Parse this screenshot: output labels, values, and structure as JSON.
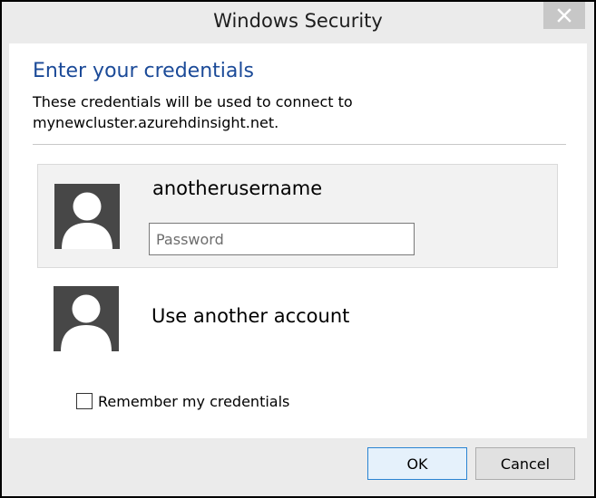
{
  "window": {
    "title": "Windows Security",
    "close_icon": "close-icon"
  },
  "dialog": {
    "heading": "Enter your credentials",
    "description": "These credentials will be used to connect to mynewcluster.azurehdinsight.net."
  },
  "accounts": [
    {
      "username": "anotherusername",
      "avatar_icon": "user-silhouette-icon",
      "password": {
        "value": "",
        "placeholder": "Password"
      }
    },
    {
      "label": "Use another account",
      "avatar_icon": "user-silhouette-icon"
    }
  ],
  "remember": {
    "label": "Remember my credentials",
    "checked": false
  },
  "buttons": {
    "ok": "OK",
    "cancel": "Cancel"
  },
  "colors": {
    "heading": "#1b4a98",
    "chrome": "#ebebeb",
    "avatar": "#474747",
    "tile": "#f2f2f2",
    "ok_border": "#2a84d2"
  }
}
